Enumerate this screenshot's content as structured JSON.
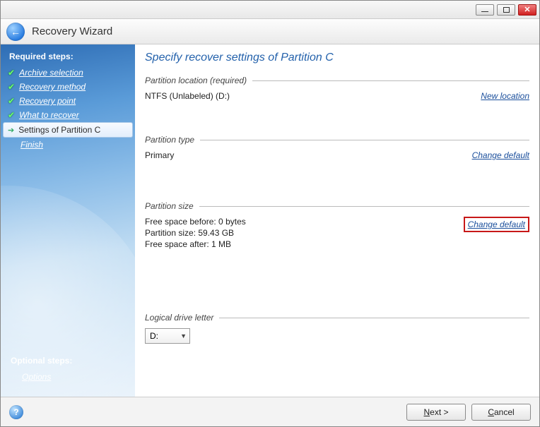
{
  "header": {
    "title": "Recovery Wizard"
  },
  "sidebar": {
    "required_title": "Required steps:",
    "items": [
      {
        "label": "Archive selection",
        "done": true,
        "current": false
      },
      {
        "label": "Recovery method",
        "done": true,
        "current": false
      },
      {
        "label": "Recovery point",
        "done": true,
        "current": false
      },
      {
        "label": "What to recover",
        "done": true,
        "current": false
      },
      {
        "label": "Settings of Partition C",
        "done": false,
        "current": true
      },
      {
        "label": "Finish",
        "done": false,
        "current": false
      }
    ],
    "optional_title": "Optional steps:",
    "optional_items": [
      {
        "label": "Options"
      }
    ]
  },
  "main": {
    "title": "Specify recover settings of Partition C",
    "location": {
      "label": "Partition location (required)",
      "value": "NTFS (Unlabeled) (D:)",
      "link": "New location"
    },
    "ptype": {
      "label": "Partition type",
      "value": "Primary",
      "link": "Change default"
    },
    "psize": {
      "label": "Partition size",
      "free_before": "Free space before: 0 bytes",
      "size": "Partition size: 59.43 GB",
      "free_after": "Free space after: 1 MB",
      "link": "Change default"
    },
    "drive": {
      "label": "Logical drive letter",
      "value": "D:"
    }
  },
  "footer": {
    "next": "Next >",
    "cancel": "Cancel"
  }
}
